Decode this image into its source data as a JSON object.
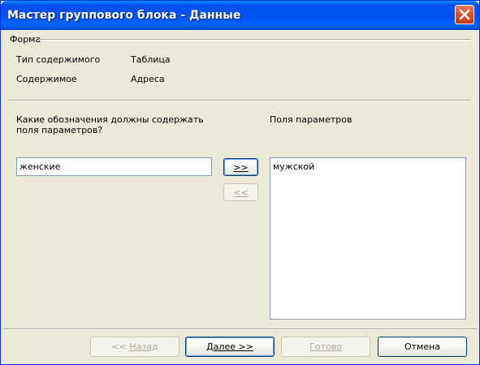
{
  "window": {
    "title": "Мастер группового блока - Данные"
  },
  "form_section": {
    "title": "Форма",
    "content_type_label": "Тип содержимого",
    "content_type_value": "Таблица",
    "content_label": "Содержимое",
    "content_value": "Адреса"
  },
  "params": {
    "question_line1": "Какие обозначения должны содержать",
    "question_line2": "поля параметров?",
    "input_value": "женские",
    "add_button": ">>",
    "remove_button": "<<",
    "list_title": "Поля параметров",
    "list_items": [
      "мужской"
    ]
  },
  "footer": {
    "back_prefix": "<< ",
    "back_label": "Назад",
    "next_label": "Далее >>",
    "finish_label": "Готово",
    "cancel_label": "Отмена"
  }
}
